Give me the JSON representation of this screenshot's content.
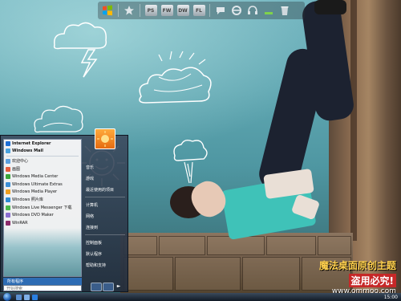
{
  "start_menu": {
    "pinned": [
      {
        "label": "Internet Explorer",
        "icon": "internet-explorer-icon",
        "bold": true
      },
      {
        "label": "Windows Mail",
        "icon": "windows-mail-icon",
        "bold": true
      }
    ],
    "recent": [
      {
        "label": "欢迎中心",
        "icon": "welcome-center-icon"
      },
      {
        "label": "画图",
        "icon": "paint-icon"
      },
      {
        "label": "Windows Media Center",
        "icon": "media-center-icon"
      },
      {
        "label": "Windows Ultimate Extras",
        "icon": "ultimate-extras-icon"
      },
      {
        "label": "Windows Media Player",
        "icon": "media-player-icon"
      },
      {
        "label": "Windows 照片库",
        "icon": "photo-gallery-icon"
      },
      {
        "label": "Windows Live Messenger 下载",
        "icon": "messenger-icon"
      },
      {
        "label": "Windows DVD Maker",
        "icon": "dvd-maker-icon"
      },
      {
        "label": "WinRAR",
        "icon": "winrar-icon"
      }
    ],
    "all_programs": "所有程序",
    "search_placeholder": "开始搜索",
    "right_panel": [
      "音乐",
      "游戏",
      "最近使用的项目",
      "计算机",
      "网络",
      "连接到",
      "控制面板",
      "默认程序",
      "帮助和支持"
    ]
  },
  "dock": {
    "items": [
      {
        "icon": "windows-logo-icon"
      },
      {
        "icon": "star-icon"
      },
      {
        "icon": "photoshop-icon",
        "label": "PS"
      },
      {
        "icon": "fireworks-icon",
        "label": "FW"
      },
      {
        "icon": "dreamweaver-icon",
        "label": "DW"
      },
      {
        "icon": "flash-icon",
        "label": "FL"
      },
      {
        "icon": "chat-icon"
      },
      {
        "icon": "internet-explorer-icon"
      },
      {
        "icon": "headphones-icon"
      },
      {
        "icon": "monitor-icon"
      },
      {
        "icon": "recycle-bin-icon"
      }
    ]
  },
  "watermark": {
    "line1": "魔法桌面原创主题",
    "line2": "盗用必究!",
    "line3": "www.ommoo.com"
  },
  "taskbar": {
    "clock": "15:00",
    "quick_launch": [
      "show-desktop-icon",
      "switch-windows-icon",
      "internet-explorer-icon"
    ]
  },
  "colors": {
    "sky": "#5fa6b1",
    "shirt": "#3fc2b8",
    "accent_blue": "#2d6cb4",
    "watermark_yellow": "#ffd04d",
    "watermark_red": "#c62828"
  }
}
